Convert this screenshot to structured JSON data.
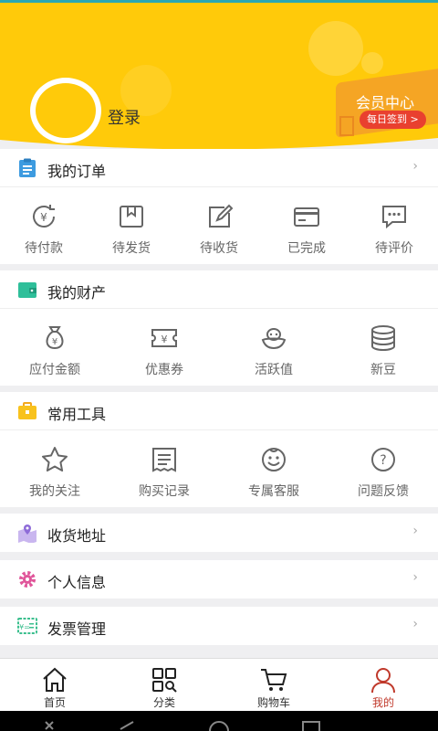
{
  "header": {
    "login_label": "登录",
    "member_center": "会员中心",
    "daily_signin": "每日签到 >"
  },
  "colors": {
    "header_yellow": "#ffca0a",
    "accent_red": "#c0392b",
    "member_orange": "#f5a524"
  },
  "orders": {
    "title": "我的订单",
    "icon": "clipboard-icon",
    "items": [
      {
        "label": "待付款",
        "icon": "yuan-refresh-icon"
      },
      {
        "label": "待发货",
        "icon": "box-icon"
      },
      {
        "label": "待收货",
        "icon": "edit-icon"
      },
      {
        "label": "已完成",
        "icon": "card-icon"
      },
      {
        "label": "待评价",
        "icon": "chat-icon"
      }
    ]
  },
  "assets": {
    "title": "我的财产",
    "icon": "wallet-icon",
    "items": [
      {
        "label": "应付金额",
        "icon": "money-bag-icon"
      },
      {
        "label": "优惠券",
        "icon": "coupon-icon"
      },
      {
        "label": "活跃值",
        "icon": "activity-icon"
      },
      {
        "label": "新豆",
        "icon": "coins-icon"
      }
    ]
  },
  "tools": {
    "title": "常用工具",
    "icon": "toolbox-icon",
    "items": [
      {
        "label": "我的关注",
        "icon": "star-icon"
      },
      {
        "label": "购买记录",
        "icon": "receipt-icon"
      },
      {
        "label": "专属客服",
        "icon": "smiley-icon"
      },
      {
        "label": "问题反馈",
        "icon": "question-icon"
      }
    ]
  },
  "rows": [
    {
      "label": "收货地址",
      "icon": "map-pin-icon"
    },
    {
      "label": "个人信息",
      "icon": "settings-gear-icon"
    },
    {
      "label": "发票管理",
      "icon": "invoice-icon"
    }
  ],
  "tabbar": [
    {
      "label": "首页",
      "icon": "home-icon",
      "active": false
    },
    {
      "label": "分类",
      "icon": "category-icon",
      "active": false
    },
    {
      "label": "购物车",
      "icon": "cart-icon",
      "active": false
    },
    {
      "label": "我的",
      "icon": "profile-icon",
      "active": true
    }
  ]
}
